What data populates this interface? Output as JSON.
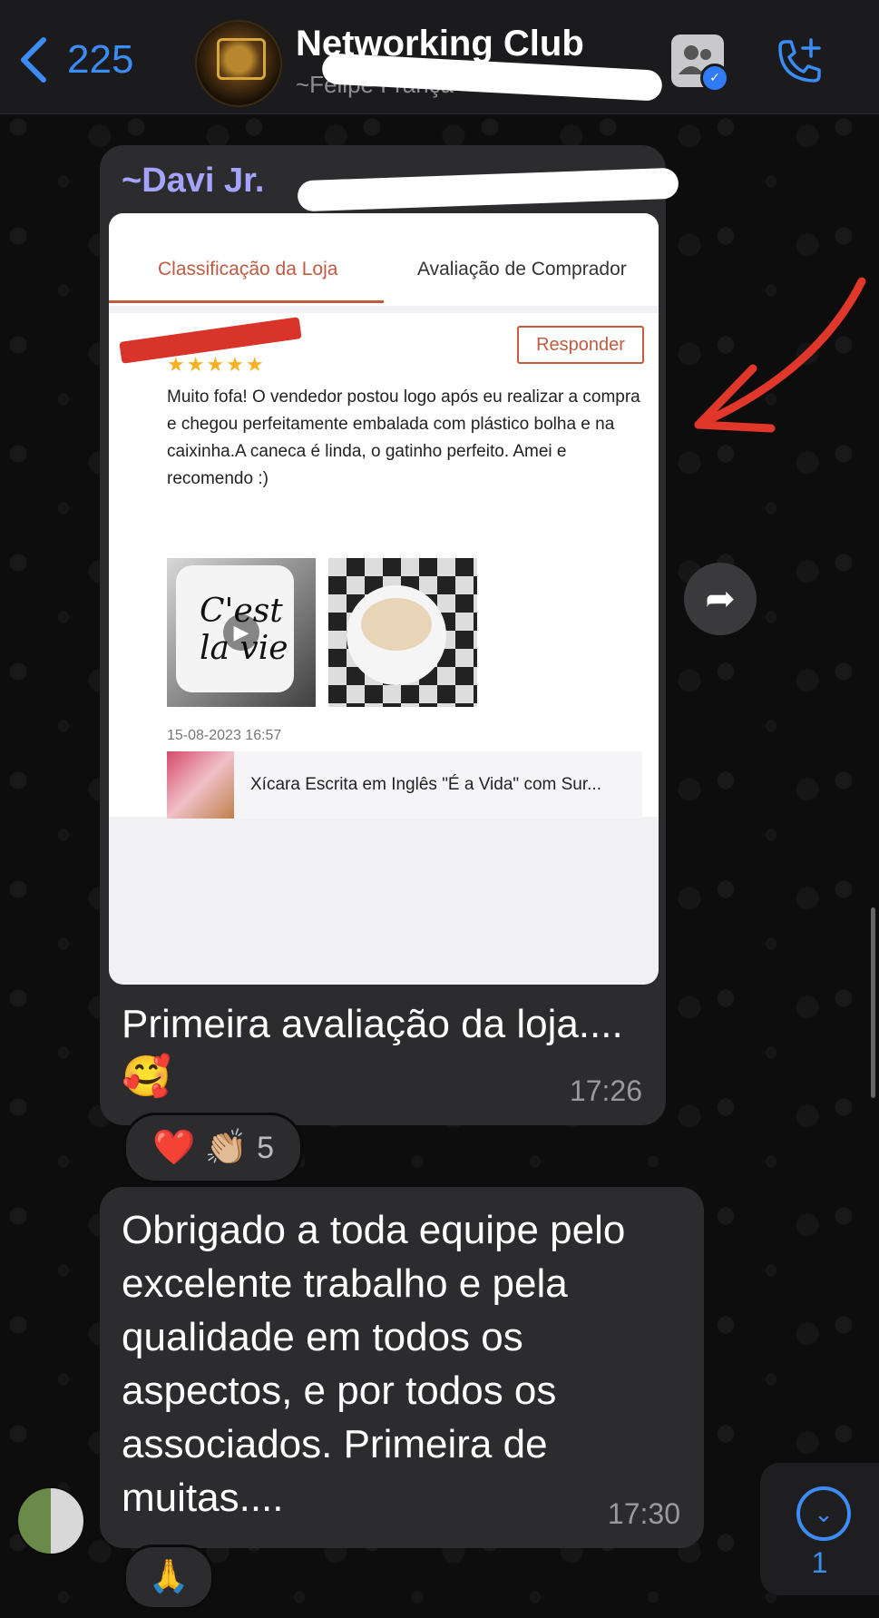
{
  "header": {
    "back_count": "225",
    "title": "Networking Club",
    "subtitle": "~Felipe França"
  },
  "messages": [
    {
      "sender": "~Davi Jr.",
      "card": {
        "tabs": [
          "Classificação da Loja",
          "Avaliação de Comprador"
        ],
        "reply_button": "Responder",
        "stars": "★★★★★",
        "review_text": "Muito fofa! O vendedor postou logo após eu realizar a compra e chegou perfeitamente embalada com plástico bolha e na caixinha.A caneca é linda, o gatinho perfeito. Amei e recomendo :)",
        "photo_caption": "C'est la vie",
        "date": "15-08-2023 16:57",
        "product_name": "Xícara Escrita em Inglês \"É a Vida\" com Sur..."
      },
      "caption": "Primeira avaliação da loja.... 🥰",
      "time": "17:26",
      "reactions": {
        "emojis": "❤️ 👏🏼",
        "count": "5"
      }
    },
    {
      "text": "Obrigado a toda equipe pelo excelente trabalho e pela qualidade em todos os aspectos, e por todos os associados.  Primeira de muitas....",
      "time": "17:30",
      "reactions": {
        "emojis": "🙏"
      }
    }
  ],
  "scroll_down": {
    "unread": "1"
  },
  "colors": {
    "accent": "#3b8cf5",
    "bubble": "#2c2c2e",
    "sender_name": "#a4a4ff",
    "shop_accent": "#c05a40",
    "annotation_arrow": "#e0372a"
  }
}
